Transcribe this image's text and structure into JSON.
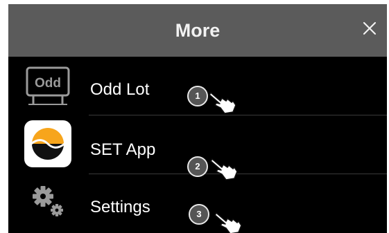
{
  "header": {
    "title": "More"
  },
  "menu": {
    "items": [
      {
        "label": "Odd Lot",
        "icon": "odd-lot-icon",
        "icon_text": "Odd"
      },
      {
        "label": "SET App",
        "icon": "set-app-icon"
      },
      {
        "label": "Settings",
        "icon": "gear-icon"
      }
    ]
  },
  "annotations": [
    {
      "number": "1"
    },
    {
      "number": "2"
    },
    {
      "number": "3"
    }
  ],
  "colors": {
    "header_bg": "#5b5b5b",
    "menu_bg": "#000000",
    "text": "#ffffff",
    "set_orange": "#f7a51c"
  }
}
